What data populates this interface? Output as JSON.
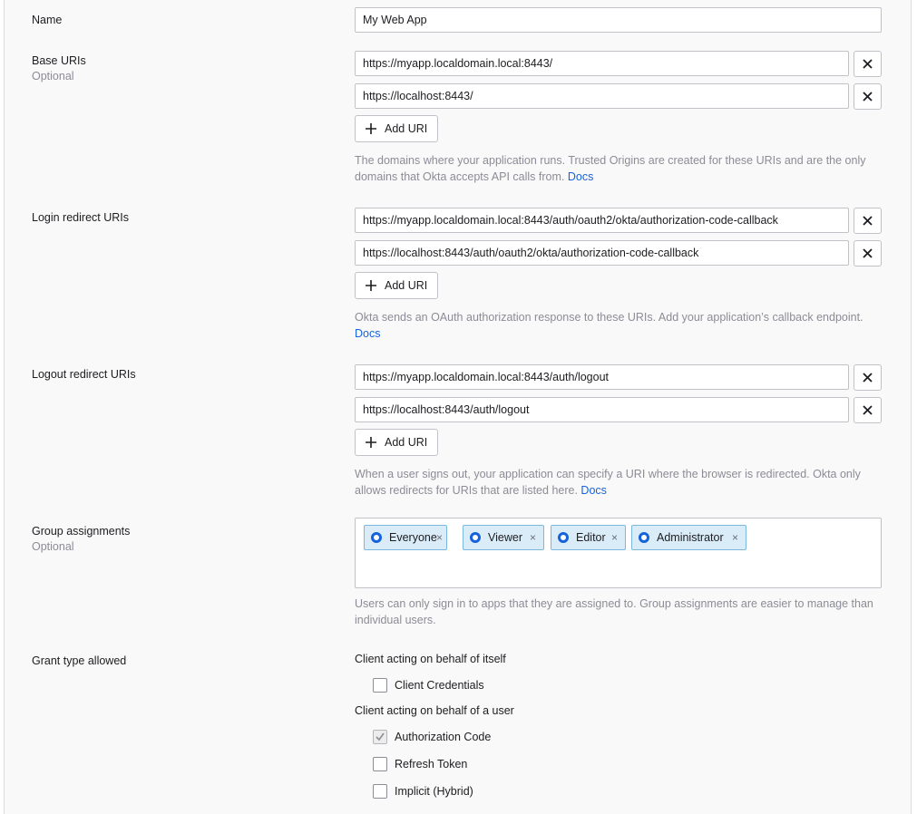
{
  "name_field": {
    "label": "Name",
    "value": "My Web App"
  },
  "base_uris": {
    "label": "Base URIs",
    "sublabel": "Optional",
    "values": [
      "https://myapp.localdomain.local:8443/",
      "https://localhost:8443/"
    ],
    "add_label": "Add URI",
    "help": "The domains where your application runs. Trusted Origins are created for these URIs and are the only domains that Okta accepts API calls from.",
    "help_link": "Docs"
  },
  "login_redirect": {
    "label": "Login redirect URIs",
    "values": [
      "https://myapp.localdomain.local:8443/auth/oauth2/okta/authorization-code-callback",
      "https://localhost:8443/auth/oauth2/okta/authorization-code-callback"
    ],
    "add_label": "Add URI",
    "help": "Okta sends an OAuth authorization response to these URIs. Add your application’s callback endpoint.",
    "help_link": "Docs"
  },
  "logout_redirect": {
    "label": "Logout redirect URIs",
    "values": [
      "https://myapp.localdomain.local:8443/auth/logout",
      "https://localhost:8443/auth/logout"
    ],
    "add_label": "Add URI",
    "help": "When a user signs out, your application can specify a URI where the browser is redirected. Okta only allows redirects for URIs that are listed here.",
    "help_link": "Docs"
  },
  "group_assignments": {
    "label": "Group assignments",
    "sublabel": "Optional",
    "chips": [
      "Everyone",
      "Viewer",
      "Editor",
      "Administrator"
    ],
    "remove_glyph": "×",
    "help": "Users can only sign in to apps that they are assigned to. Group assignments are easier to manage than individual users."
  },
  "grant_types": {
    "label": "Grant type allowed",
    "group1_label": "Client acting on behalf of itself",
    "client_credentials": "Client Credentials",
    "group2_label": "Client acting on behalf of a user",
    "authorization_code": "Authorization Code",
    "refresh_token": "Refresh Token",
    "implicit": "Implicit (Hybrid)",
    "checked": [
      "Authorization Code"
    ]
  },
  "icons": {
    "remove": "close-icon",
    "add": "plus-icon",
    "group": "group-ring-icon",
    "check": "checkmark-icon"
  },
  "colors": {
    "link": "#1662dd",
    "chip_bg": "#d9ecf8",
    "chip_border": "#7ab8e0",
    "ring": "#1662dd"
  }
}
